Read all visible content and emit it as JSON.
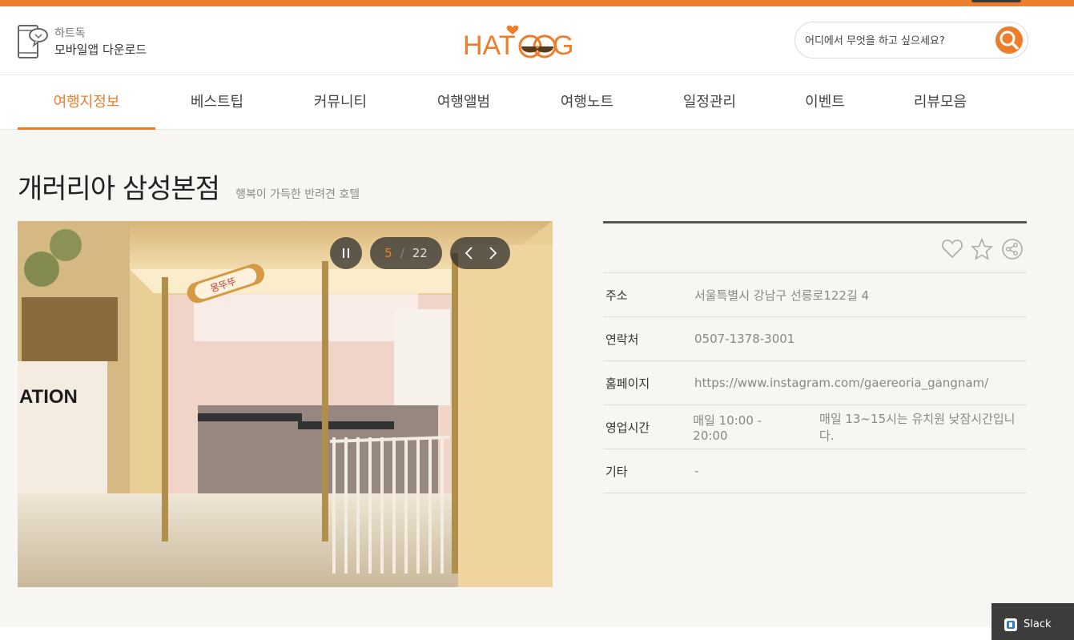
{
  "header": {
    "app_line1": "하트독",
    "app_line2": "모바일앱 다운로드",
    "logo_text": "HATDOG",
    "search_placeholder": "어디에서 무엇을 하고 싶으세요?"
  },
  "nav": {
    "items": [
      "여행지정보",
      "베스트팁",
      "커뮤니티",
      "여행앨범",
      "여행노트",
      "일정관리",
      "이벤트",
      "리뷰모음"
    ],
    "active_index": 0
  },
  "place": {
    "title": "개러리아 삼성본점",
    "subtitle": "행복이 가득한 반려견 호텔",
    "photo_sign": "몽뚜뚜",
    "photo_wall_text": "ATION"
  },
  "slider": {
    "current": "5",
    "separator": "/",
    "total": "22"
  },
  "info": {
    "rows": [
      {
        "label": "주소",
        "value": "서울특별시 강남구 선릉로122길 4",
        "extra": ""
      },
      {
        "label": "연락처",
        "value": "0507-1378-3001",
        "extra": ""
      },
      {
        "label": "홈페이지",
        "value": "https://www.instagram.com/gaereoria_gangnam/",
        "extra": ""
      },
      {
        "label": "영업시간",
        "value": "매일 10:00 - 20:00",
        "extra": "매일 13~15시는 유치원 낮잠시간입니다."
      },
      {
        "label": "기타",
        "value": "-",
        "extra": ""
      }
    ]
  },
  "overlay": {
    "slack_label": "Slack"
  },
  "colors": {
    "accent": "#ee7d2b",
    "background": "#f7f6f2"
  },
  "icons": [
    "phone-download-icon",
    "search-icon",
    "pause-icon",
    "chevron-left-icon",
    "chevron-right-icon",
    "heart-icon",
    "star-icon",
    "share-icon",
    "slack-icon"
  ]
}
